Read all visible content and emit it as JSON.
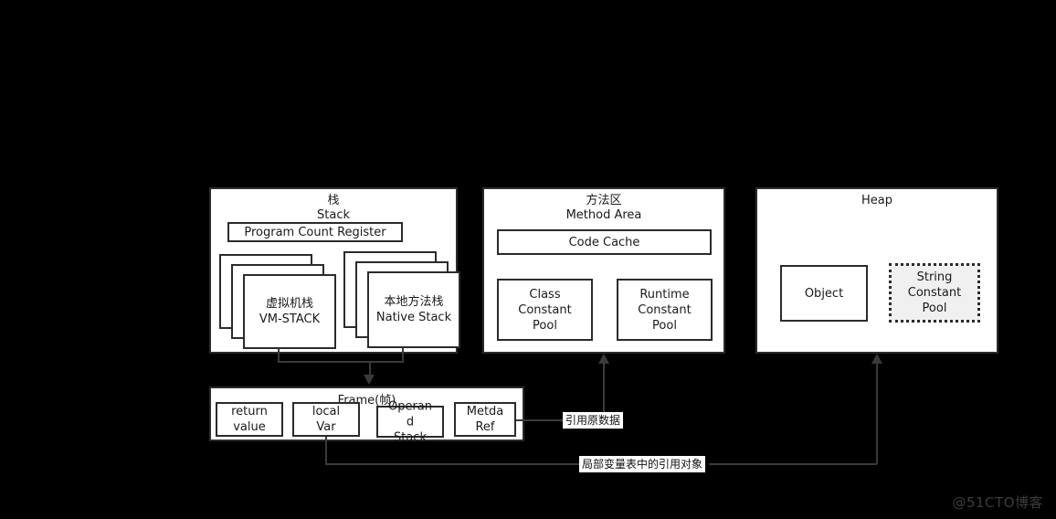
{
  "diagram": {
    "title_watermark": "@51CTO博客",
    "regions": [
      {
        "id": "stack",
        "title": "栈\nStack",
        "children": {
          "pc_register": "Program Count Register",
          "vm_stack": "虚拟机栈\nVM-STACK",
          "native_stack": "本地方法栈\nNative Stack"
        }
      },
      {
        "id": "method-area",
        "title": "方法区\nMethod Area",
        "children": {
          "code_cache": "Code Cache",
          "class_constant_pool": "Class\nConstant\nPool",
          "runtime_constant_pool": "Runtime\nConstant\nPool"
        }
      },
      {
        "id": "heap",
        "title": "Heap",
        "children": {
          "object": "Object",
          "string_constant_pool": "String\nConstant\nPool"
        }
      }
    ],
    "frame": {
      "title": "Frame(帧)",
      "slots": [
        "return\nvalue",
        "local\nVar",
        "Operan\nd\nStack",
        "Metda\nRef"
      ]
    },
    "edges": {
      "meta_ref_label": "引用原数据",
      "local_var_label": "局部变量表中的引用对象"
    }
  }
}
